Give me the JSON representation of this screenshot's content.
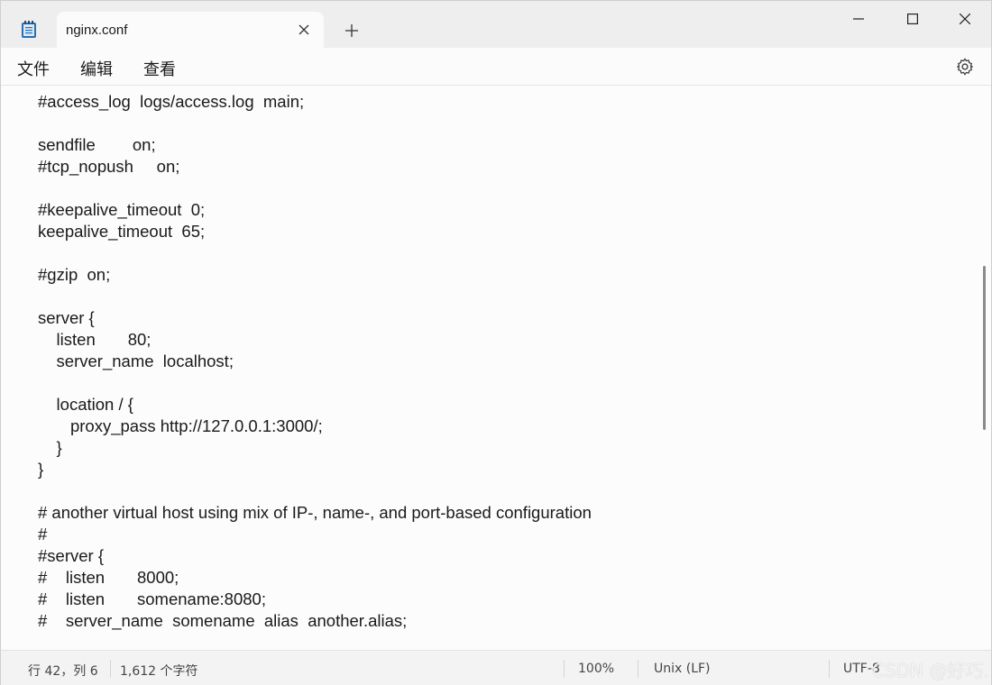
{
  "tab": {
    "title": "nginx.conf"
  },
  "menu": {
    "file": "文件",
    "edit": "编辑",
    "view": "查看"
  },
  "editor": {
    "lines": [
      "#access_log  logs/access.log  main;",
      "",
      "sendfile        on;",
      "#tcp_nopush     on;",
      "",
      "#keepalive_timeout  0;",
      "keepalive_timeout  65;",
      "",
      "#gzip  on;",
      "",
      "server {",
      "    listen       80;",
      "    server_name  localhost;",
      "",
      "    location / {",
      "       proxy_pass http://127.0.0.1:3000/;",
      "    }",
      "}",
      "",
      "# another virtual host using mix of IP-, name-, and port-based configuration",
      "#",
      "#server {",
      "#    listen       8000;",
      "#    listen       somename:8080;",
      "#    server_name  somename  alias  another.alias;"
    ]
  },
  "status": {
    "position": "行 42，列 6",
    "char_count": "1,612 个字符",
    "zoom": "100%",
    "line_ending": "Unix (LF)",
    "encoding": "UTF-8"
  },
  "watermark": "CSDN @好巧."
}
